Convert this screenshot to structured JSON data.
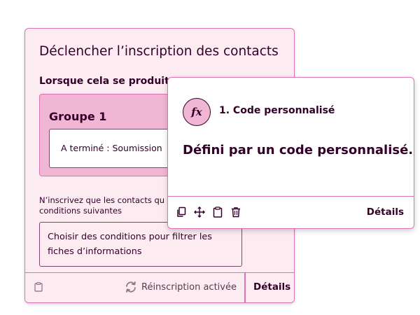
{
  "trigger": {
    "title": "Déclencher l’inscription des contacts",
    "when_label": "Lorsque cela se produit",
    "group": {
      "title": "Groupe 1",
      "criteria": "A terminé : Soumission"
    },
    "restrict_text": "N’inscrivez que les contacts qui remplissent les conditions suivantes",
    "restrict_visible_line1": "N’inscrivez que les contacts qu",
    "restrict_visible_line2": "conditions suivantes",
    "conditions_button": "Choisir des conditions pour filtrer les fiches d’informations",
    "reenrollment": "Réinscription activée",
    "details": "Détails"
  },
  "action": {
    "badge": "fx",
    "name": "1. Code personnalisé",
    "description": "Défini par un code personnalisé.",
    "details": "Détails",
    "tools": [
      "copy-icon",
      "move-icon",
      "clipboard-icon",
      "trash-icon"
    ]
  },
  "colors": {
    "card_background": "#fdebf2",
    "group_background": "#f1b6d4",
    "border_accent": "#d973b4",
    "text_dark": "#33002a"
  }
}
